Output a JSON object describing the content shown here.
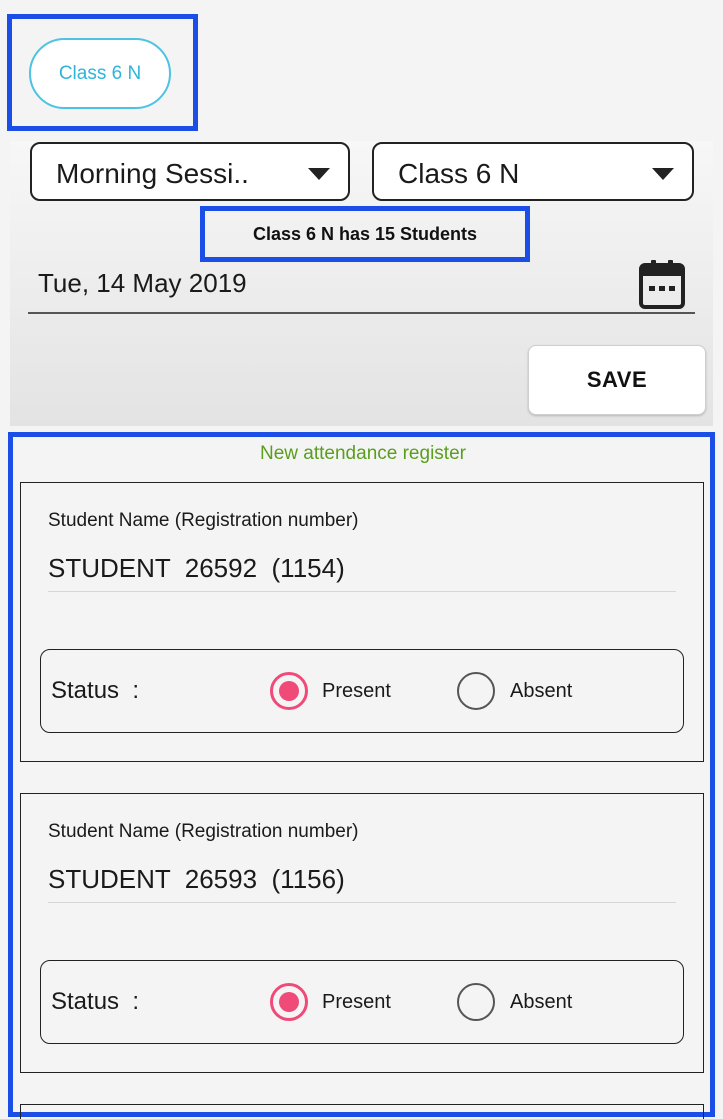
{
  "chip": {
    "label": "Class 6 N"
  },
  "filters": {
    "session": "Morning Sessi..",
    "class": "Class 6 N"
  },
  "student_count_text": "Class 6 N has 15 Students",
  "date": "Tue, 14 May 2019",
  "save_label": "SAVE",
  "register_title": "New attendance register",
  "colors": {
    "highlight": "#1a4ee6",
    "chip_accent": "#4cc3e3",
    "register_title": "#5a9e1e",
    "radio_selected": "#ef4a78"
  },
  "students": [
    {
      "field_label": "Student Name (Registration number)",
      "name": "STUDENT  26592  (1154)",
      "status_label": "Status  :",
      "present_label": "Present",
      "absent_label": "Absent",
      "selected": "present"
    },
    {
      "field_label": "Student Name (Registration number)",
      "name": "STUDENT  26593  (1156)",
      "status_label": "Status  :",
      "present_label": "Present",
      "absent_label": "Absent",
      "selected": "present"
    }
  ],
  "icons": {
    "calendar": "calendar-icon",
    "dropdown": "dropdown-arrow-icon"
  }
}
